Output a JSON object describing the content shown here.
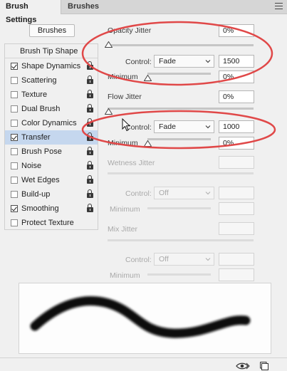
{
  "tabs": [
    {
      "label": "Brush Settings"
    },
    {
      "label": "Brushes"
    }
  ],
  "brushes_button": "Brushes",
  "left_panel": {
    "header": "Brush Tip Shape",
    "items": [
      {
        "label": "Shape Dynamics",
        "checked": true
      },
      {
        "label": "Scattering",
        "checked": false
      },
      {
        "label": "Texture",
        "checked": false
      },
      {
        "label": "Dual Brush",
        "checked": false
      },
      {
        "label": "Color Dynamics",
        "checked": false
      },
      {
        "label": "Transfer",
        "checked": true,
        "selected": true
      },
      {
        "label": "Brush Pose",
        "checked": false
      },
      {
        "label": "Noise",
        "checked": false
      },
      {
        "label": "Wet Edges",
        "checked": false
      },
      {
        "label": "Build-up",
        "checked": false
      },
      {
        "label": "Smoothing",
        "checked": true
      },
      {
        "label": "Protect Texture",
        "checked": false
      }
    ]
  },
  "transfer": {
    "opacity_jitter": {
      "label": "Opacity Jitter",
      "value": "0%",
      "level": 0
    },
    "opacity_control": {
      "label": "Control:",
      "value": "Fade",
      "steps": "1500"
    },
    "opacity_minimum": {
      "label": "Minimum",
      "value": "0%",
      "level": 0
    },
    "flow_jitter": {
      "label": "Flow Jitter",
      "value": "0%",
      "level": 0
    },
    "flow_control": {
      "label": "Control:",
      "value": "Fade",
      "steps": "1000"
    },
    "flow_minimum": {
      "label": "Minimum",
      "value": "0%",
      "level": 0
    },
    "wetness_jitter": {
      "label": "Wetness Jitter",
      "value": ""
    },
    "wetness_control": {
      "label": "Control:",
      "value": "Off"
    },
    "wetness_minimum": {
      "label": "Minimum",
      "value": ""
    },
    "mix_jitter": {
      "label": "Mix Jitter",
      "value": ""
    },
    "mix_control": {
      "label": "Control:",
      "value": "Off"
    },
    "mix_minimum": {
      "label": "Minimum",
      "value": ""
    }
  },
  "colors": {
    "selected_row": "#c5d7ee",
    "annotation": "#e04848"
  },
  "icons": {
    "visibility": "eye-icon",
    "new_preset": "new-preset-icon",
    "lock": "lock-icon",
    "menu": "panel-menu-icon"
  }
}
